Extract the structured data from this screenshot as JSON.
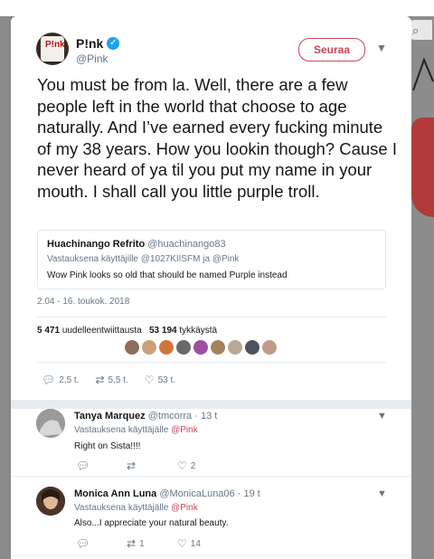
{
  "tweet": {
    "display_name": "P!nk",
    "handle": "@Pink",
    "follow_label": "Seuraa",
    "text": "You must be from la. Well, there are a few people left in the world that choose to age naturally. And I’ve earned every fucking minute of my 38 years. How you lookin though? Cause I never heard of ya til you put my name in your mouth. I shall call you little purple troll.",
    "quote": {
      "name": "Huachinango Refrito",
      "handle": "@huachinango83",
      "reply_to": "Vastauksena käyttäjille @1027KIISFM ja @Pink",
      "text": "Wow Pink looks so old that should be named Purple instead"
    },
    "timestamp": "2.04 - 16. toukok. 2018",
    "retweets_count": "5 471",
    "retweets_label": "uudelleentwiittausta",
    "likes_count": "53 194",
    "likes_label": "tykkäystä",
    "actions": {
      "replies": "2,5 t.",
      "retweets": "5,5 t.",
      "likes": "53 t."
    }
  },
  "replies": [
    {
      "name": "Tanya Marquez",
      "handle": "@tmcorra",
      "time": "· 13 t",
      "reply_to_prefix": "Vastauksena käyttäjälle",
      "reply_to_user": "@Pink",
      "text": "Right on Sista!!!!",
      "replies": "",
      "retweets": "",
      "likes": "2"
    },
    {
      "name": "Monica Ann Luna",
      "handle": "@MonicaLuna06",
      "time": "· 19 t",
      "reply_to_prefix": "Vastauksena käyttäjälle",
      "reply_to_user": "@Pink",
      "text": "Also...I appreciate your natural beauty.",
      "replies": "",
      "retweets": "1",
      "likes": "14"
    }
  ],
  "colors": {
    "accent": "#c6465a",
    "verified": "#1da1f2",
    "muted": "#657786"
  },
  "icons": {
    "reply": "reply-icon",
    "retweet": "retweet-icon",
    "like": "heart-icon",
    "more": "chevron-down-icon",
    "verified": "verified-badge-icon"
  }
}
